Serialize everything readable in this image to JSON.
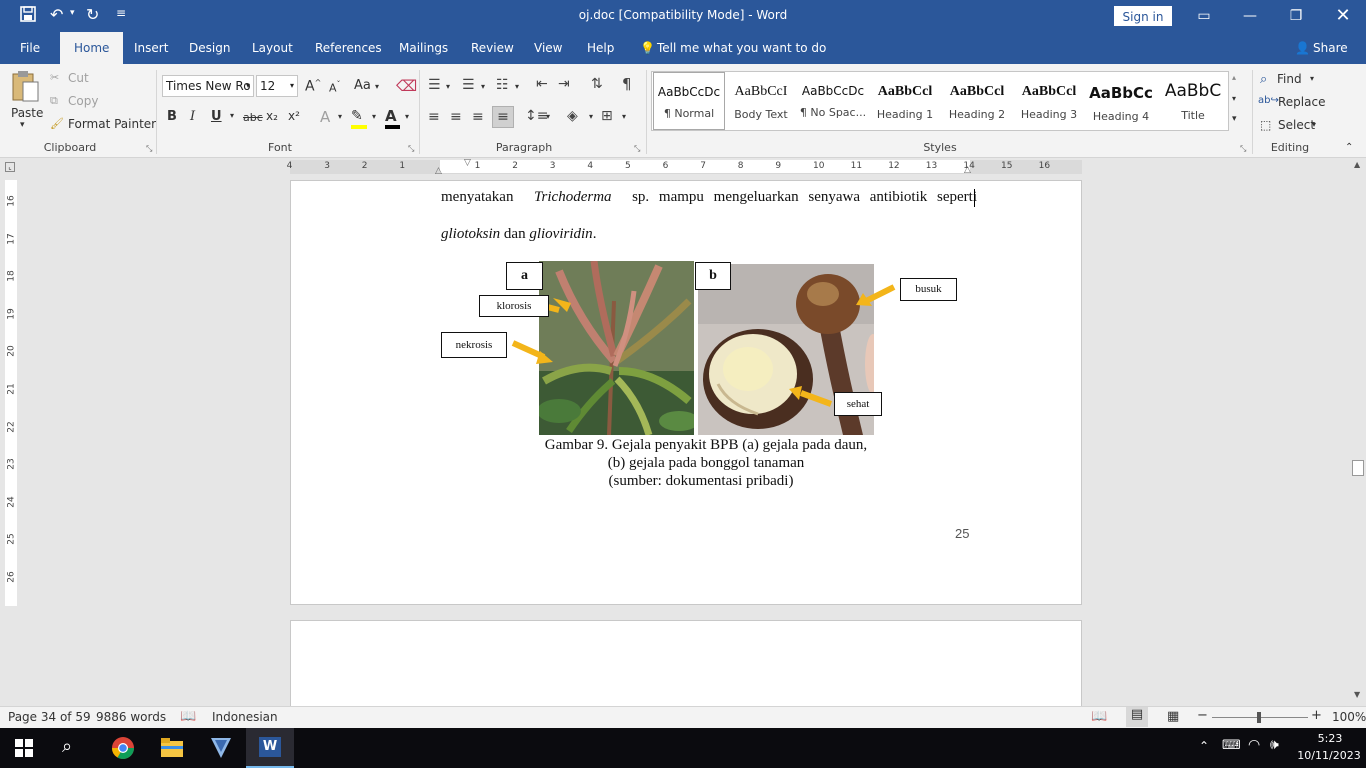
{
  "window": {
    "title": "oj.doc [Compatibility Mode]  -  Word",
    "sign_in": "Sign in",
    "minimize_icon": "minimize-icon",
    "restore_icon": "restore-icon",
    "close_icon": "close-icon"
  },
  "menu": {
    "file": "File",
    "home": "Home",
    "insert": "Insert",
    "design": "Design",
    "layout": "Layout",
    "references": "References",
    "mailings": "Mailings",
    "review": "Review",
    "view": "View",
    "help": "Help",
    "tell_me": "Tell me what you want to do",
    "share": "Share"
  },
  "ribbon": {
    "clipboard": {
      "paste": "Paste",
      "cut": "Cut",
      "copy": "Copy",
      "format_painter": "Format Painter",
      "label": "Clipboard"
    },
    "font": {
      "name": "Times New Ro",
      "size": "12",
      "label": "Font",
      "bold": "B",
      "italic": "I",
      "underline": "U",
      "strike": "abc",
      "subscript": "x₂",
      "superscript": "x²",
      "grow": "A",
      "shrink": "A",
      "change_case": "Aa"
    },
    "paragraph": {
      "label": "Paragraph"
    },
    "styles": {
      "label": "Styles",
      "items": [
        {
          "preview": "AaBbCcDc",
          "name": "¶ Normal"
        },
        {
          "preview": "AaBbCcI",
          "name": "Body Text"
        },
        {
          "preview": "AaBbCcDc",
          "name": "¶ No Spac..."
        },
        {
          "preview": "AaBbCcl",
          "name": "Heading 1"
        },
        {
          "preview": "AaBbCcl",
          "name": "Heading 2"
        },
        {
          "preview": "AaBbCcl",
          "name": "Heading 3"
        },
        {
          "preview": "AaBbCc",
          "name": "Heading 4"
        },
        {
          "preview": "AaBbC",
          "name": "Title"
        }
      ]
    },
    "editing": {
      "label": "Editing",
      "find": "Find",
      "replace": "Replace",
      "select": "Select"
    }
  },
  "ruler": {
    "h_ticks": [
      "4",
      "3",
      "2",
      "1",
      "1",
      "2",
      "3",
      "4",
      "5",
      "6",
      "7",
      "8",
      "9",
      "10",
      "11",
      "12",
      "13",
      "14",
      "15",
      "16"
    ],
    "v_ticks": [
      "16",
      "17",
      "18",
      "19",
      "20",
      "21",
      "22",
      "23",
      "24",
      "25",
      "26"
    ]
  },
  "document": {
    "line1_a": "menyatakan",
    "line1_b": "Trichoderma",
    "line1_c": "sp.  mampu  mengeluarkan  senyawa  antibiotik  seperti",
    "line2_a": "gliotoksin",
    "line2_b": "dan",
    "line2_c": "glioviridin",
    "line2_d": ".",
    "fig_label_a": "a",
    "fig_label_b": "b",
    "label_klorosis": "klorosis",
    "label_nekrosis": "nekrosis",
    "label_busuk": "busuk",
    "label_sehat": "sehat",
    "caption1": "Gambar 9. Gejala penyakit BPB (a) gejala pada daun,",
    "caption2": "(b) gejala pada bonggol tanaman",
    "caption3": "(sumber: dokumentasi pribadi)",
    "page_number": "25"
  },
  "status": {
    "page": "Page 34 of 59",
    "words": "9886 words",
    "language": "Indonesian",
    "zoom": "100%"
  },
  "taskbar": {
    "time": "5:23",
    "date": "10/11/2023"
  }
}
